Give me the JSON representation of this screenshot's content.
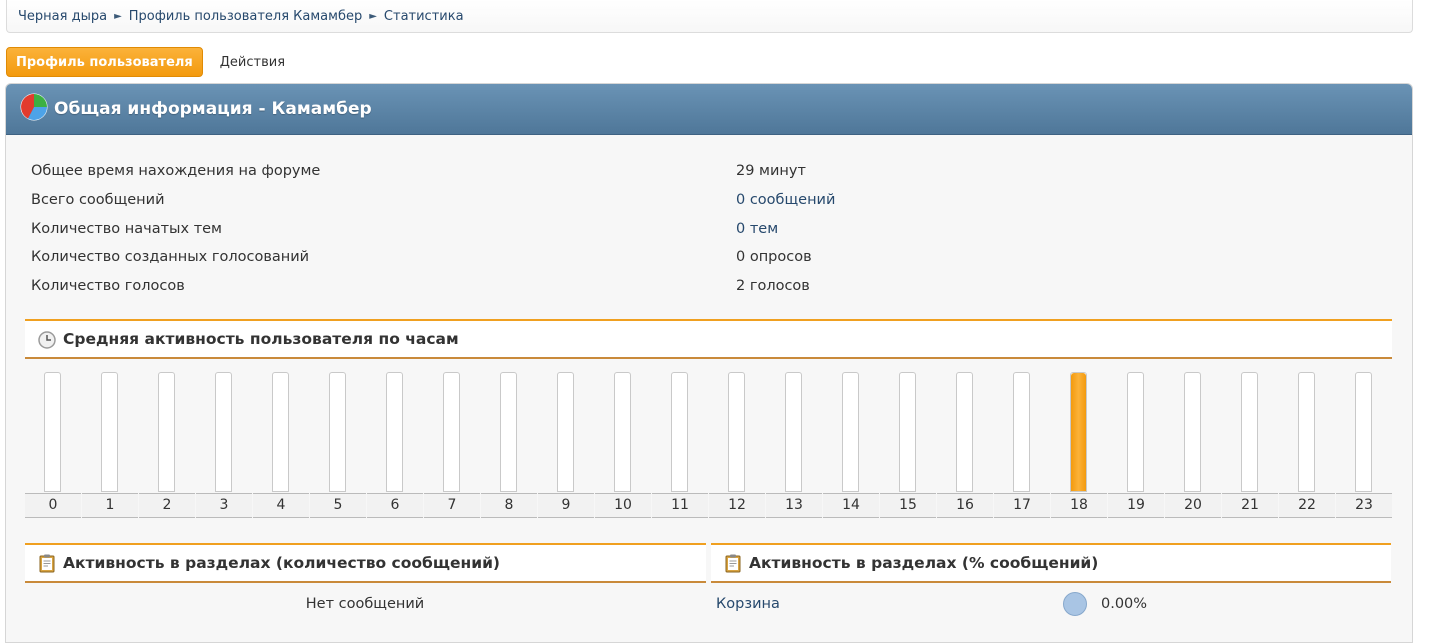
{
  "breadcrumb": {
    "items": [
      "Черная дыра",
      "Профиль пользователя Камамбер",
      "Статистика"
    ],
    "separator": "►"
  },
  "tabs": {
    "active_label": "Профиль пользователя",
    "other_label": "Действия"
  },
  "panel": {
    "title": "Общая информация - Камамбер"
  },
  "stats": [
    {
      "label": "Общее время нахождения на форуме",
      "value": "29 минут"
    },
    {
      "label": "Всего сообщений",
      "value": "0 сообщений"
    },
    {
      "label": "Количество начатых тем",
      "value": "0 тем"
    },
    {
      "label": "Количество созданных голосований",
      "value": "0 опросов"
    },
    {
      "label": "Количество голосов",
      "value": "2 голосов"
    }
  ],
  "hourly": {
    "title": "Средняя активность пользователя по часам",
    "hours": [
      "0",
      "1",
      "2",
      "3",
      "4",
      "5",
      "6",
      "7",
      "8",
      "9",
      "10",
      "11",
      "12",
      "13",
      "14",
      "15",
      "16",
      "17",
      "18",
      "19",
      "20",
      "21",
      "22",
      "23"
    ],
    "activity": [
      0,
      0,
      0,
      0,
      0,
      0,
      0,
      0,
      0,
      0,
      0,
      0,
      0,
      0,
      0,
      0,
      0,
      0,
      1,
      0,
      0,
      0,
      0,
      0
    ],
    "accent_color": "#f39a0e"
  },
  "sections_count": {
    "title": "Активность в разделах (количество сообщений)",
    "empty_message": "Нет сообщений"
  },
  "sections_percent": {
    "title": "Активность в разделах (% сообщений)",
    "forum": "Корзина",
    "percent": "0.00%"
  },
  "colors": {
    "header_blue": "#5a82a5",
    "tab_orange": "#f39a0e",
    "link": "#27496d"
  }
}
